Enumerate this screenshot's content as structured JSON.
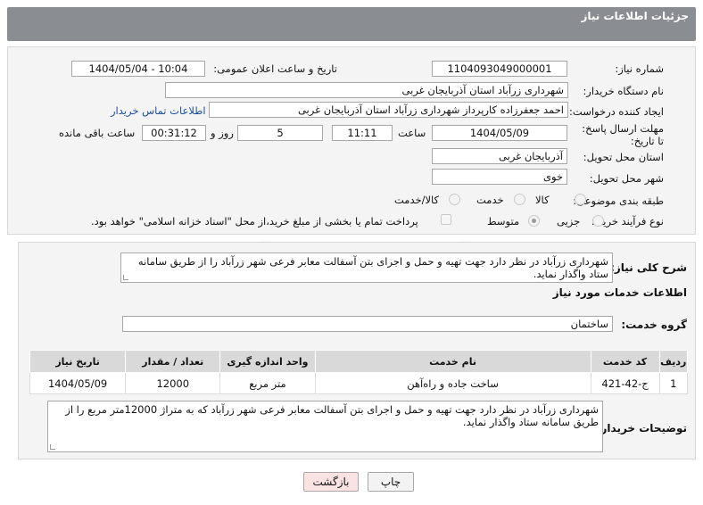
{
  "header": {
    "title": "جزئیات اطلاعات نیاز"
  },
  "form": {
    "need_number_label": "شماره نیاز:",
    "need_number": "1104093049000001",
    "announce_label": "تاریخ و ساعت اعلان عمومی:",
    "announce_value": "1404/05/04 - 10:04",
    "buyer_org_label": "نام دستگاه خریدار:",
    "buyer_org": "شهرداری زرآباد استان آذربایجان غربی",
    "creator_label": "ایجاد کننده درخواست:",
    "creator": "احمد جعفرزاده کارپرداز شهرداری زرآباد استان آذربایجان غربی",
    "contact_link": "اطلاعات تماس خریدار",
    "deadline_label": "مهلت ارسال پاسخ: تا تاریخ:",
    "deadline_date": "1404/05/09",
    "time_label": "ساعت",
    "deadline_time": "11:11",
    "days_value": "5",
    "days_label": "روز و",
    "remaining_time": "00:31:12",
    "remaining_label": "ساعت باقی مانده",
    "province_label": "استان محل تحویل:",
    "province": "آذربایجان غربی",
    "city_label": "شهر محل تحویل:",
    "city": "خوی",
    "category_label": "طبقه بندی موضوعی:",
    "category_options": [
      "کالا",
      "خدمت",
      "کالا/خدمت"
    ],
    "process_label": "نوع فرآیند خرید :",
    "process_options": [
      "جزیی",
      "متوسط"
    ],
    "payment_note": "پرداخت تمام یا بخشی از مبلغ خرید،از محل \"اسناد خزانه اسلامی\" خواهد بود."
  },
  "details": {
    "summary_label": "شرح کلی نیاز:",
    "summary": "شهرداری زرآباد در نظر دارد جهت تهیه و حمل و اجرای بتن آسفالت معابر فرعی شهر زرآباد را از طریق سامانه ستاد واگذار نماید.",
    "services_title": "اطلاعات خدمات مورد نیاز",
    "service_group_label": "گروه خدمت:",
    "service_group": "ساختمان"
  },
  "table": {
    "headers": [
      "ردیف",
      "کد خدمت",
      "نام خدمت",
      "واحد اندازه گیری",
      "تعداد / مقدار",
      "تاریخ نیاز"
    ],
    "rows": [
      [
        "1",
        "ج-42-421",
        "ساخت جاده و راه‌آهن",
        "متر مربع",
        "12000",
        "1404/05/09"
      ]
    ]
  },
  "buyer_notes_label": "توضیحات خریدار:",
  "buyer_notes": "شهرداری زرآباد در نظر دارد جهت تهیه و حمل و اجرای بتن آسفالت معابر فرعی شهر زرآباد که به متراژ 12000متر مربع  را از طریق سامانه ستاد واگذار نماید.",
  "buttons": {
    "print": "چاپ",
    "back": "بازگشت"
  },
  "watermark": "AriaTender.neT"
}
